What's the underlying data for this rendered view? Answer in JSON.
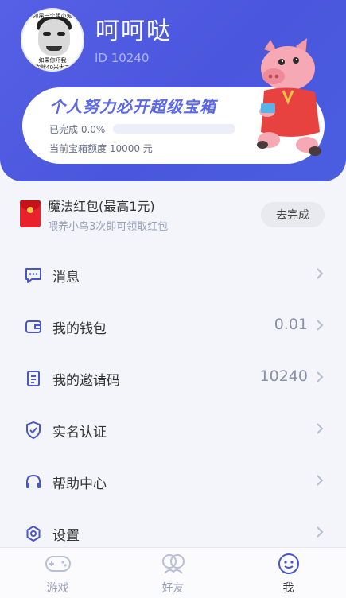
{
  "profile": {
    "name": "呵呵哒",
    "id_text": "ID 10240",
    "avatar_caption_top": "如果一个胆小鬼",
    "avatar_caption_bottom": "如果你吓我\n你就40米大刀"
  },
  "task_card": {
    "title": "个人努力必开超级宝箱",
    "progress_label": "已完成 0.0%",
    "progress_value": 0.0,
    "quota_label": "当前宝箱额度 10000 元"
  },
  "red_packet": {
    "title": "魔法红包(最高1元)",
    "subtitle": "喂养小鸟3次即可领取红包",
    "button_label": "去完成"
  },
  "menu": [
    {
      "key": "messages",
      "label": "消息",
      "value": "",
      "icon": "message-icon"
    },
    {
      "key": "wallet",
      "label": "我的钱包",
      "value": "0.01",
      "icon": "wallet-icon"
    },
    {
      "key": "invite",
      "label": "我的邀请码",
      "value": "10240",
      "icon": "invite-code-icon"
    },
    {
      "key": "verify",
      "label": "实名认证",
      "value": "",
      "icon": "shield-check-icon"
    },
    {
      "key": "help",
      "label": "帮助中心",
      "value": "",
      "icon": "headset-icon"
    },
    {
      "key": "settings",
      "label": "设置",
      "value": "",
      "icon": "gear-icon"
    }
  ],
  "tabbar": {
    "tabs": [
      {
        "label": "游戏",
        "icon": "gamepad-icon",
        "active": false
      },
      {
        "label": "好友",
        "icon": "friends-icon",
        "active": false
      },
      {
        "label": "我",
        "icon": "smiley-icon",
        "active": true
      }
    ]
  },
  "colors": {
    "accent": "#5a67ea",
    "header_gradient_start": "#5560e6",
    "red_packet": "#e8212b"
  }
}
